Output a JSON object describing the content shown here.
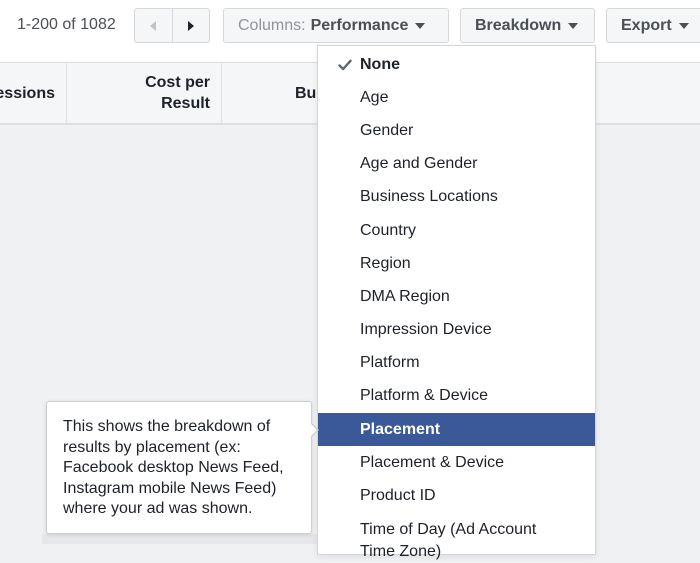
{
  "toolbar": {
    "pager_label": "1-200 of 1082",
    "prev_icon": "triangle-left-icon",
    "next_icon": "triangle-right-icon",
    "columns_prefix": "Columns:",
    "columns_value": "Performance",
    "breakdown_label": "Breakdown",
    "export_label": "Export",
    "caret_icon": "caret-down-icon"
  },
  "table": {
    "headers": [
      "essions",
      "Cost per Result",
      "Bu"
    ]
  },
  "breakdown_menu": {
    "selected": "None",
    "highlighted": "Placement",
    "check_icon": "checkmark-icon",
    "items": [
      "None",
      "Age",
      "Gender",
      "Age and Gender",
      "Business Locations",
      "Country",
      "Region",
      "DMA Region",
      "Impression Device",
      "Platform",
      "Platform & Device",
      "Placement",
      "Placement & Device",
      "Product ID",
      "Time of Day (Ad Account Time Zone)"
    ]
  },
  "tooltip": {
    "text": "This shows the breakdown of results by placement (ex: Facebook desktop News Feed, Instagram mobile News Feed) where your ad was shown."
  },
  "colors": {
    "highlight": "#3b5998",
    "button_bg": "#f5f6f7",
    "page_bg": "#f0f1f3"
  }
}
